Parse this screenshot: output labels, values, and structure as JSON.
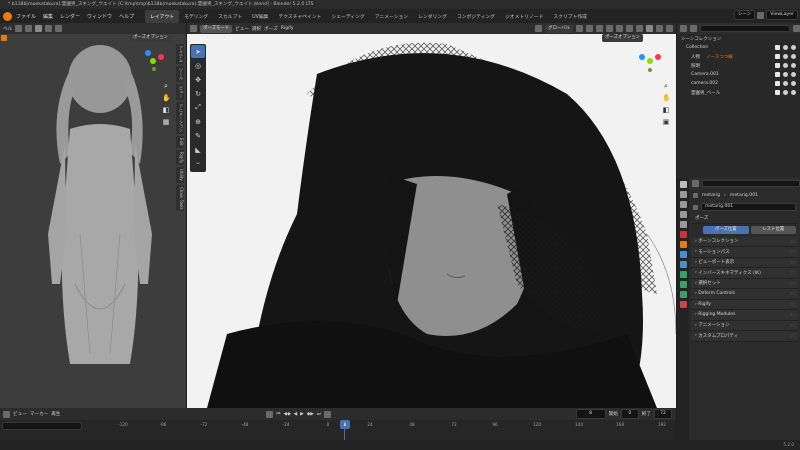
{
  "window_title": "* b118b[moekatakura]:霊園男_スキング_ウエイト [C:\\tmp\\tmp\\b118b(moekatakura):霊園男_スキング_ウエイト.blend] - Blender 5.2.0 LTS",
  "menu": [
    "ファイル",
    "編集",
    "レンダー",
    "ウィンドウ",
    "ヘルプ"
  ],
  "workspaces": [
    "レイアウト",
    "モデリング",
    "スカルプト",
    "UV編集",
    "テクスチャペイント",
    "シェーディング",
    "アニメーション",
    "レンダリング",
    "コンポジティング",
    "ジオメトリノード",
    "スクリプト作成"
  ],
  "active_workspace": "レイアウト",
  "scene_name": "シーン",
  "view_layer": "ViewLayer",
  "left_viewport": {
    "header_left": "ベル",
    "pose_options": "ポーズオプション",
    "side_tabs": [
      "アイテム",
      "ツール",
      "ビュー",
      "アニメーション",
      "Edit",
      "Rigify",
      "Utility",
      "Chain Tools"
    ]
  },
  "main_viewport": {
    "mode": "ポーズモード",
    "menus": [
      "ビュー",
      "選択",
      "ポーズ",
      "Rigify"
    ],
    "orientation": "グローバル",
    "pose_options": "ポーズオプション",
    "tools": [
      "cursor-arrow",
      "circle-select",
      "move",
      "rotate",
      "scale",
      "transform",
      "annotate",
      "measure",
      "relax"
    ]
  },
  "outliner": {
    "search_placeholder": "",
    "rows": [
      {
        "label": "シーンコレクション",
        "indent": 0
      },
      {
        "label": "Collection",
        "indent": 1
      },
      {
        "label": "人物",
        "indent": 2
      },
      {
        "label": "照明",
        "indent": 2
      },
      {
        "label": "Camera.001",
        "indent": 2
      },
      {
        "label": "camera.002",
        "indent": 2
      },
      {
        "label": "霊園男_ベール",
        "indent": 2
      }
    ],
    "tag_text": "ノースつつ線"
  },
  "properties": {
    "breadcrumb": [
      "metarig",
      "metarig.001"
    ],
    "armature_name": "metarig.001",
    "section": "ポーズ",
    "pose_buttons": [
      "ポーズ位置",
      "レスト位置"
    ],
    "panels": [
      "ボーンコレクション",
      "モーションパス",
      "ビューポート表示",
      "インバースキネマティクス (IK)",
      "選択セット",
      "Deform Controls",
      "Rigify",
      "Rigging Modules",
      "アニメーション",
      "カスタムプロパティ"
    ]
  },
  "timeline": {
    "menus": [
      "ビュー",
      "マーカー"
    ],
    "keying": "再生",
    "current_frame": "8",
    "start_label": "開始",
    "start": "0",
    "end_label": "終了",
    "end": "72",
    "ruler": [
      "-120",
      "-96",
      "-72",
      "-48",
      "-24",
      "0",
      "24",
      "48",
      "72",
      "96",
      "120",
      "144",
      "168",
      "192"
    ],
    "playhead": "8"
  },
  "status": {
    "version": "5.2.0"
  },
  "colors": {
    "accent": "#4772b3",
    "blender_orange": "#e87d0d",
    "active_tab": "#3d3d3d"
  }
}
